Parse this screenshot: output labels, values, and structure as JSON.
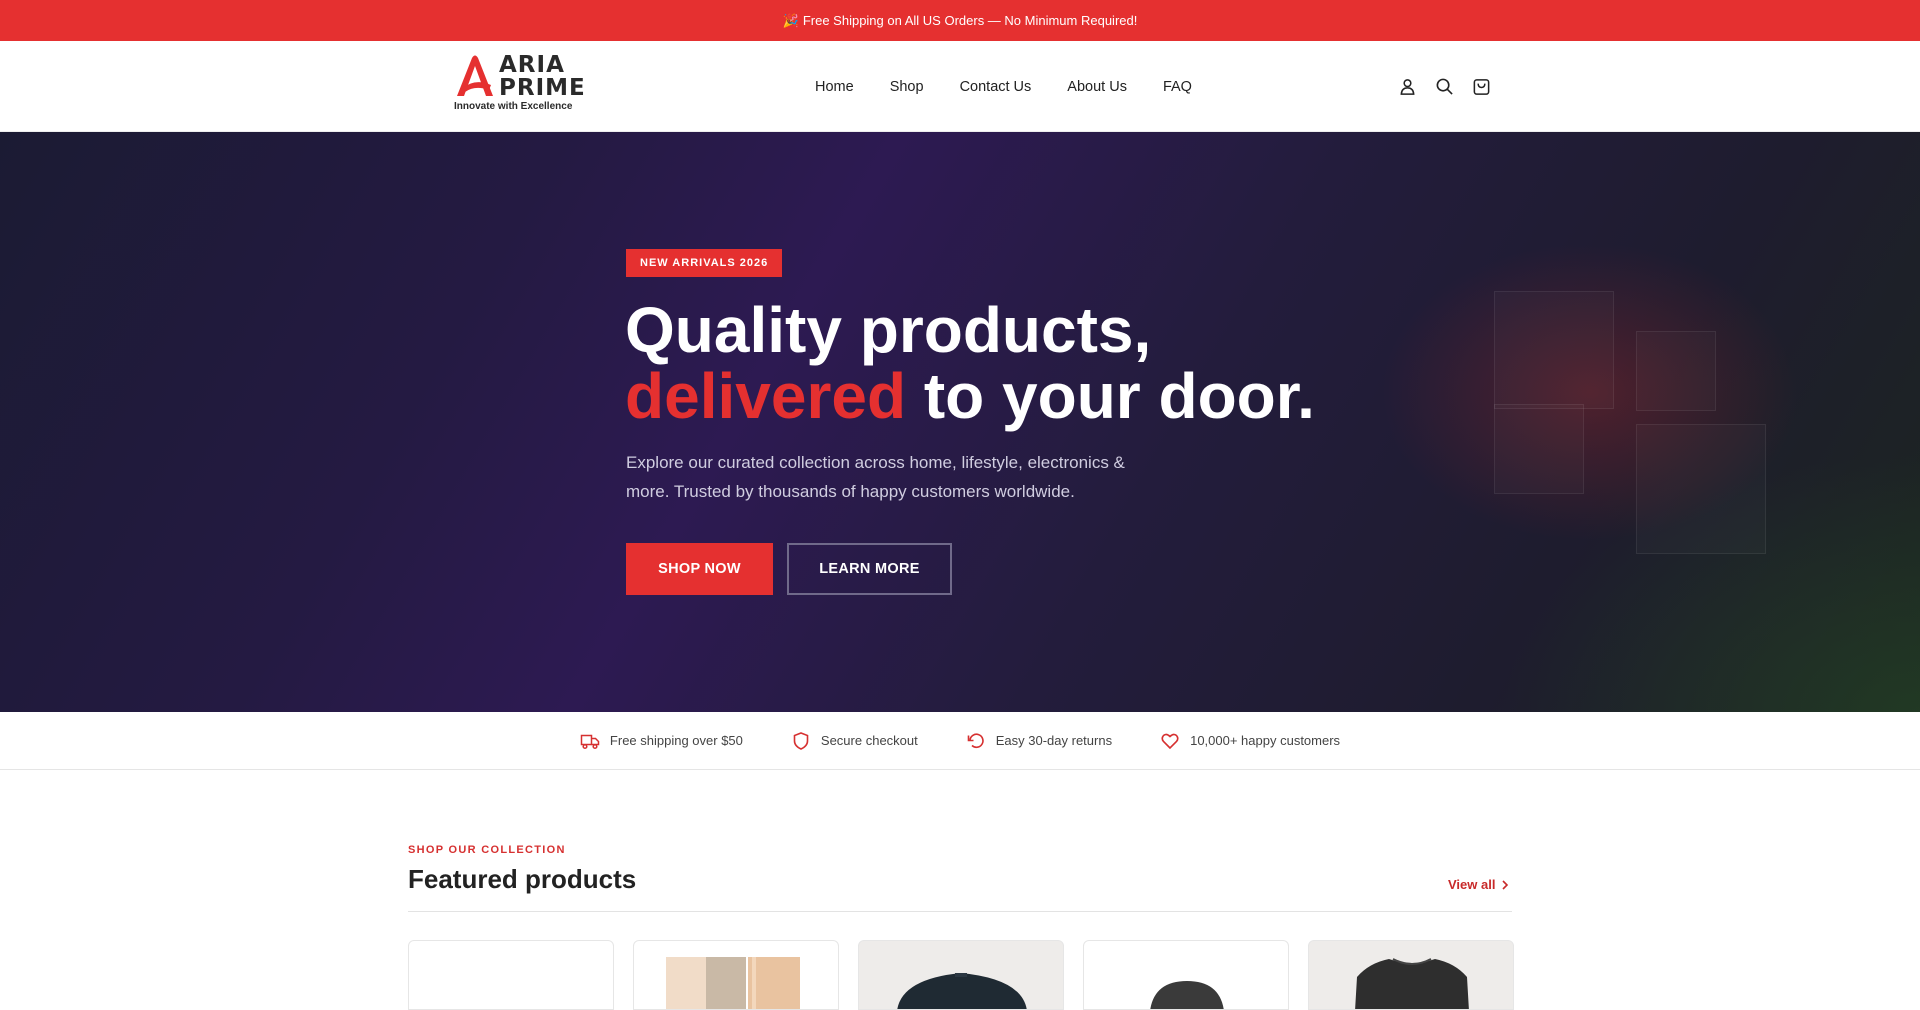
{
  "announcement": {
    "emoji": "🎉",
    "text": "Free Shipping on All US Orders — No Minimum Required!"
  },
  "brand": {
    "line1": "ARIA",
    "line2": "PRIME",
    "tagline": "Innovate with Excellence",
    "accent": "#e53030"
  },
  "nav": {
    "items": [
      "Home",
      "Shop",
      "Contact Us",
      "About Us",
      "FAQ"
    ]
  },
  "header_icons": [
    "account-icon",
    "search-icon",
    "cart-icon"
  ],
  "hero": {
    "badge": "NEW ARRIVALS 2026",
    "title_line1": "Quality products,",
    "title_highlight": "delivered",
    "title_rest": " to your door.",
    "subtitle": "Explore our curated collection across home, lifestyle, electronics & more. Trusted by thousands of happy customers worldwide.",
    "primary_cta": "SHOP NOW",
    "secondary_cta": "LEARN MORE"
  },
  "perks": [
    {
      "icon": "truck-icon",
      "label": "Free shipping over $50"
    },
    {
      "icon": "shield-icon",
      "label": "Secure checkout"
    },
    {
      "icon": "return-icon",
      "label": "Easy 30-day returns"
    },
    {
      "icon": "heart-icon",
      "label": "10,000+ happy customers"
    }
  ],
  "featured": {
    "kicker": "SHOP OUR COLLECTION",
    "title": "Featured products",
    "view_all": "View all"
  }
}
